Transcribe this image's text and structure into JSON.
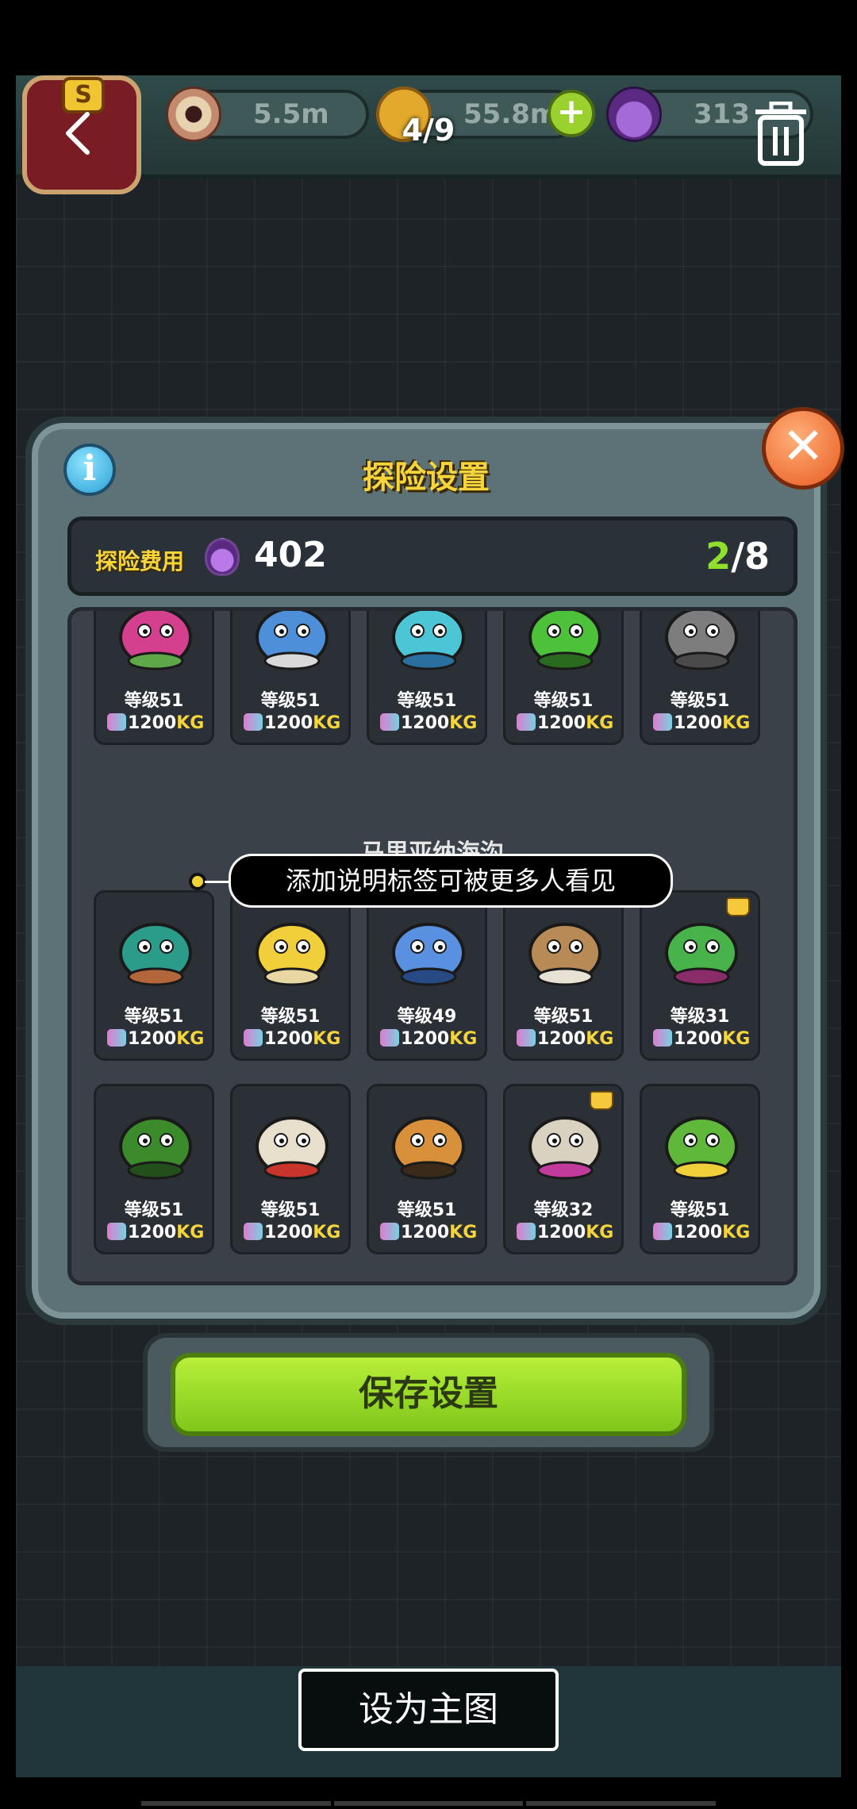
{
  "viewer": {
    "counter": "4/9",
    "set_main_label": "设为主图"
  },
  "hud": {
    "eyes": "5.5m",
    "coins": "55.8m",
    "potions": "313"
  },
  "panel": {
    "title": "探险设置",
    "cost_label": "探险费用",
    "cost_value": "402",
    "slots_current": "2",
    "slots_total": "/8",
    "section_title": "马里亚纳海沟",
    "save_label": "保存设置"
  },
  "tooltip": "添加说明标签可被更多人看见",
  "weight_unit": "KG",
  "monsters_row1": [
    {
      "level": "等级51",
      "weight": "1200",
      "icon": "pink-plant-monster-icon"
    },
    {
      "level": "等级51",
      "weight": "1200",
      "icon": "snail-robot-monster-icon"
    },
    {
      "level": "等级51",
      "weight": "1200",
      "icon": "blue-fish-monster-icon"
    },
    {
      "level": "等级51",
      "weight": "1200",
      "icon": "green-caterpillar-monster-icon"
    },
    {
      "level": "等级51",
      "weight": "1200",
      "icon": "rock-golem-monster-icon"
    }
  ],
  "monsters_row2": [
    {
      "level": "等级51",
      "weight": "1200",
      "icon": "anemone-monster-icon"
    },
    {
      "level": "等级51",
      "weight": "1200",
      "icon": "banana-squid-monster-icon"
    },
    {
      "level": "等级49",
      "weight": "1200",
      "icon": "blue-crab-monster-icon"
    },
    {
      "level": "等级51",
      "weight": "1200",
      "icon": "walrus-monster-icon"
    },
    {
      "level": "等级31",
      "weight": "1200",
      "icon": "mantis-monster-icon",
      "crown": true
    }
  ],
  "monsters_row3": [
    {
      "level": "等级51",
      "weight": "1200",
      "icon": "sea-cucumber-monster-icon"
    },
    {
      "level": "等级51",
      "weight": "1200",
      "icon": "shell-monster-icon"
    },
    {
      "level": "等级51",
      "weight": "1200",
      "icon": "tiger-shrimp-monster-icon"
    },
    {
      "level": "等级32",
      "weight": "1200",
      "icon": "urchin-monster-icon",
      "crown": true
    },
    {
      "level": "等级51",
      "weight": "1200",
      "icon": "seahorse-monster-icon"
    }
  ],
  "colors": {
    "accent_yellow": "#f6d53c",
    "save_green": "#9bdc2a",
    "slots_green": "#8fe02c"
  }
}
